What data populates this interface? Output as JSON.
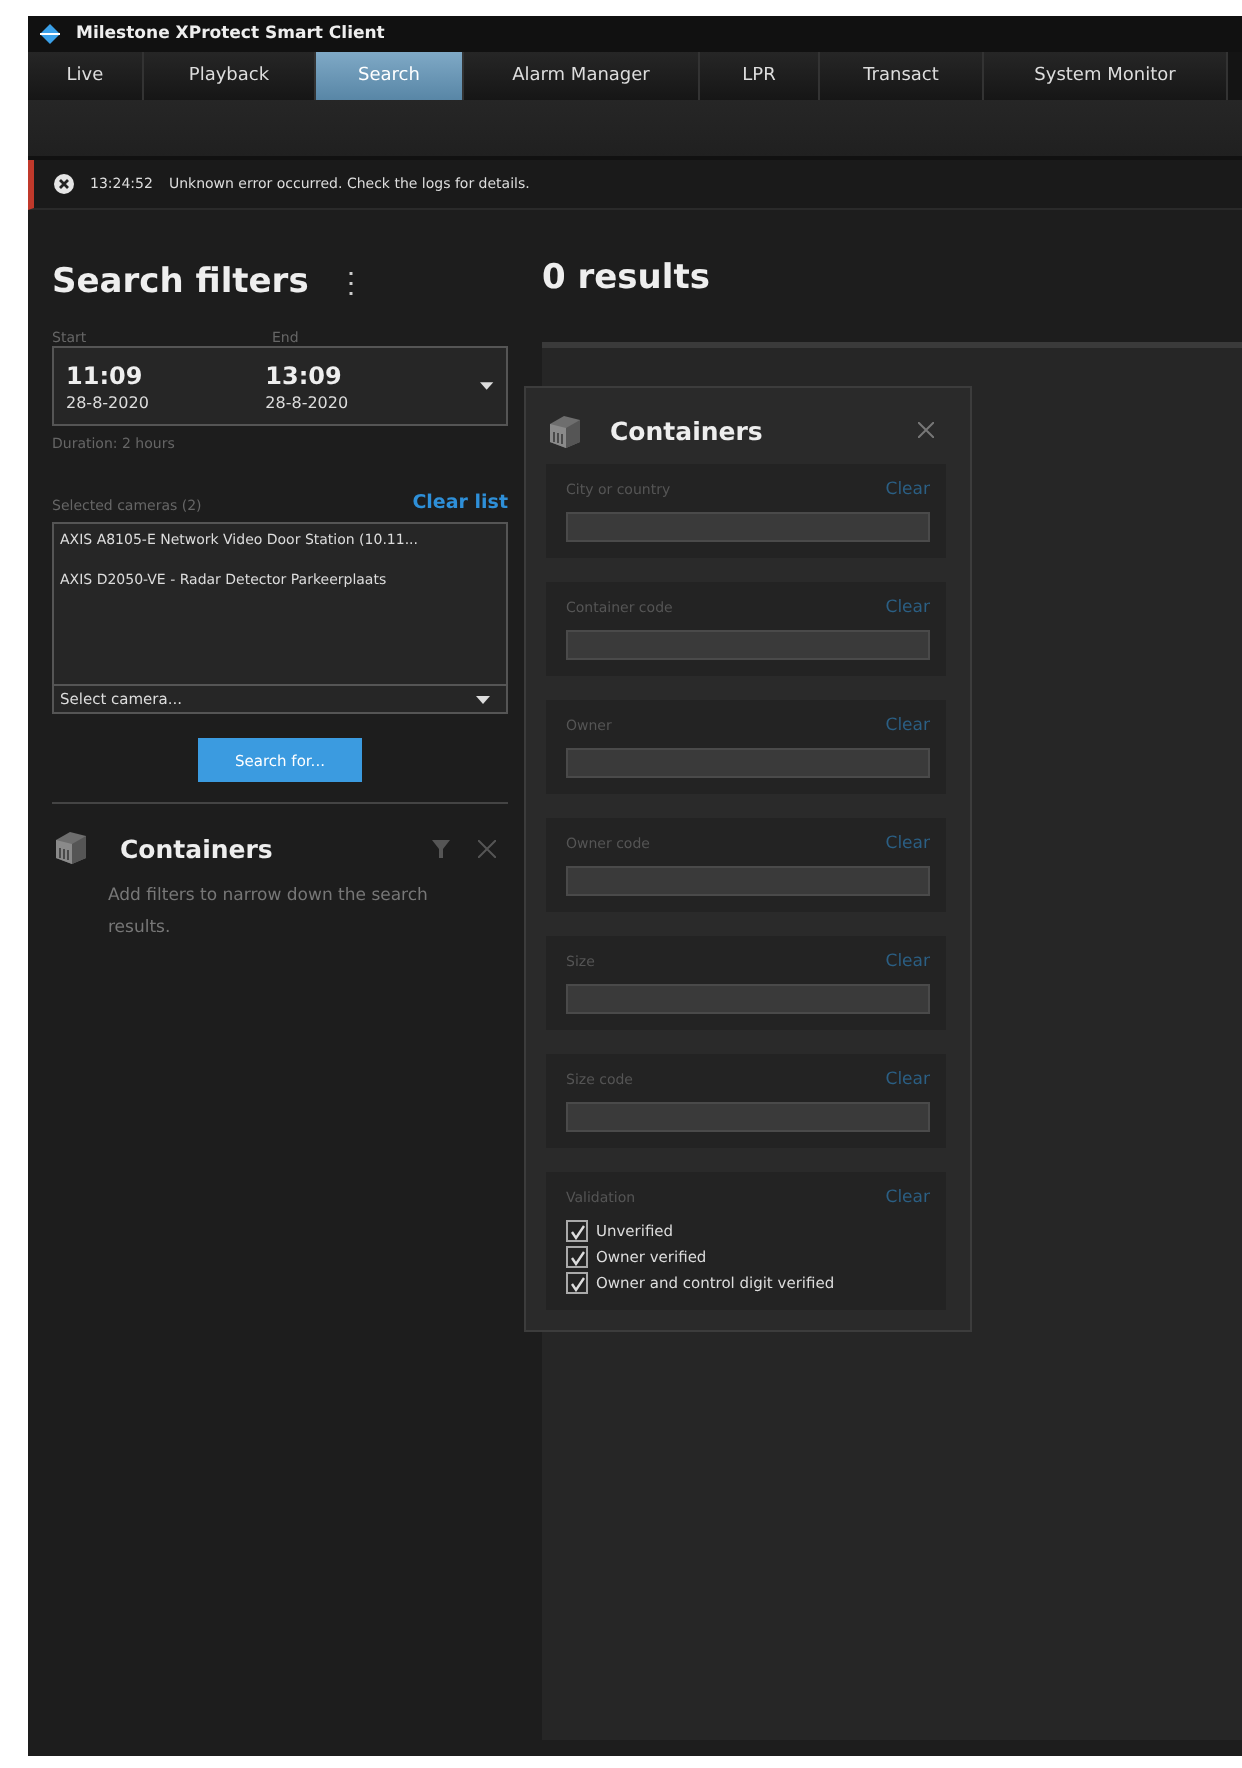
{
  "window": {
    "title": "Milestone XProtect Smart Client"
  },
  "tabs": [
    {
      "label": "Live",
      "selected": false
    },
    {
      "label": "Playback",
      "selected": false
    },
    {
      "label": "Search",
      "selected": true
    },
    {
      "label": "Alarm Manager",
      "selected": false
    },
    {
      "label": "LPR",
      "selected": false
    },
    {
      "label": "Transact",
      "selected": false
    },
    {
      "label": "System Monitor",
      "selected": false
    }
  ],
  "error_bar": {
    "time": "13:24:52",
    "message": "Unknown error occurred. Check the logs for details."
  },
  "search_filters": {
    "title": "Search filters",
    "menu": "⋮",
    "start": {
      "label": "Start",
      "time": "11:09",
      "date": "28-8-2020"
    },
    "end": {
      "label": "End",
      "time": "13:09",
      "date": "28-8-2020"
    },
    "duration": "Duration: 2 hours",
    "cameras_label": "Selected cameras (2)",
    "clear_list": "Clear list",
    "cameras": [
      "AXIS A8105-E Network Video Door Station (10.11...",
      "AXIS D2050-VE - Radar Detector Parkeerplaats"
    ],
    "select_camera": "Select camera...",
    "search_button": "Search for...",
    "containers": {
      "title": "Containers",
      "hint": "Add filters to narrow down the search results."
    }
  },
  "results": {
    "title": "0 results"
  },
  "popup": {
    "title": "Containers",
    "filters": [
      {
        "kind": "text",
        "label": "City or country",
        "clear": "Clear"
      },
      {
        "kind": "text",
        "label": "Container code",
        "clear": "Clear"
      },
      {
        "kind": "text",
        "label": "Owner",
        "clear": "Clear"
      },
      {
        "kind": "text",
        "label": "Owner code",
        "clear": "Clear"
      },
      {
        "kind": "text",
        "label": "Size",
        "clear": "Clear"
      },
      {
        "kind": "text",
        "label": "Size code",
        "clear": "Clear"
      },
      {
        "kind": "checks",
        "label": "Validation",
        "clear": "Clear",
        "options": [
          {
            "label": "Unverified",
            "checked": true
          },
          {
            "label": "Owner verified",
            "checked": true
          },
          {
            "label": "Owner and control digit verified",
            "checked": true
          }
        ]
      }
    ]
  }
}
